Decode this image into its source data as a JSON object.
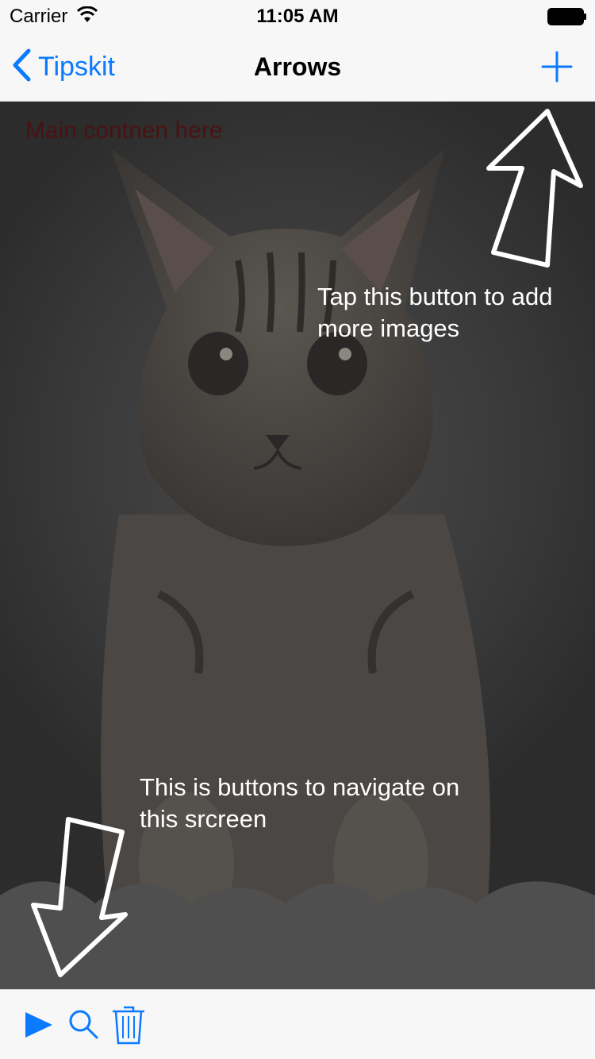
{
  "status_bar": {
    "carrier": "Carrier",
    "time": "11:05 AM",
    "wifi_icon": "wifi-icon",
    "battery_icon": "battery-icon"
  },
  "nav_bar": {
    "back_label": "Tipskit",
    "title": "Arrows",
    "add_icon": "plus-icon"
  },
  "content": {
    "main_text": "Main contnen here",
    "hint_add": "Tap this button to add more images",
    "hint_nav": "This is buttons to navigate on this srcreen"
  },
  "toolbar": {
    "buttons": [
      "play-icon",
      "search-icon",
      "trash-icon"
    ]
  },
  "colors": {
    "accent": "#0a7aff",
    "overlay_text": "#ffffff",
    "main_text": "#4a1212"
  }
}
